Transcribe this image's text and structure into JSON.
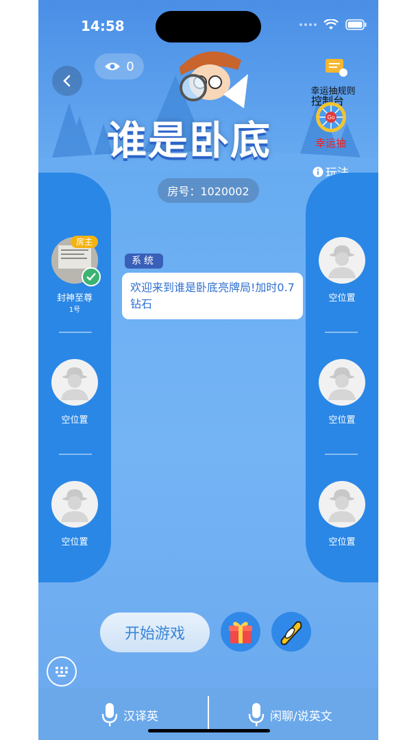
{
  "status_bar": {
    "time": "14:58"
  },
  "header": {
    "viewer_count": "0",
    "title": "谁是卧底",
    "rules_label": "幸运抽规则",
    "console_label": "控制台",
    "lucky_draw_label": "幸运抽",
    "lucky_go_text": "Go",
    "how_to_play_label": "玩法",
    "room_number": "房号：1020002"
  },
  "left_seats": [
    {
      "name": "封神至尊",
      "number": "1号",
      "badge": "房主",
      "occupied": true
    },
    {
      "name": "空位置",
      "occupied": false
    },
    {
      "name": "空位置",
      "occupied": false
    }
  ],
  "right_seats": [
    {
      "name": "空位置",
      "occupied": false
    },
    {
      "name": "空位置",
      "occupied": false
    },
    {
      "name": "空位置",
      "occupied": false
    }
  ],
  "chat": {
    "system_tag": "系统",
    "system_message": "欢迎来到谁是卧底亮牌局!加时0.7钻石"
  },
  "actions": {
    "start_game_label": "开始游戏"
  },
  "bottom_bar": {
    "left_label": "汉译英",
    "right_label": "闲聊/说英文"
  },
  "colors": {
    "panel": "#2a87e6",
    "background": "#6aaef2",
    "host_badge": "#f4b312",
    "lucky_label": "#ee2222"
  }
}
